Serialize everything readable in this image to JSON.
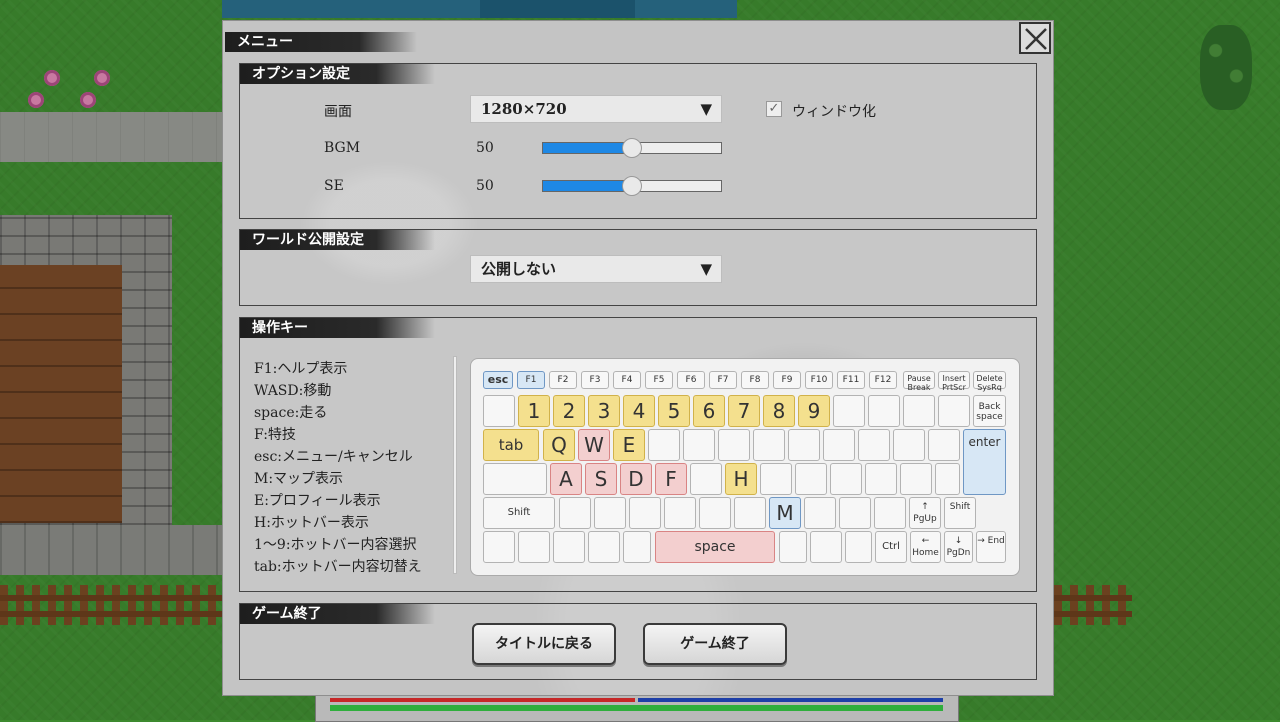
{
  "menu": {
    "title": "メニュー",
    "close_label": "×"
  },
  "options": {
    "title": "オプション設定",
    "screen": {
      "label": "画面",
      "value": "1280×720",
      "caret": "▼"
    },
    "windowed": {
      "label": "ウィンドウ化",
      "checked": true,
      "mark": "✓"
    },
    "bgm": {
      "label": "BGM",
      "value": "50",
      "level": 0.5
    },
    "se": {
      "label": "SE",
      "value": "50",
      "level": 0.5
    }
  },
  "world": {
    "title": "ワールド公開設定",
    "value": "公開しない",
    "caret": "▼"
  },
  "controls": {
    "title": "操作キー",
    "list": [
      "F1:ヘルプ表示",
      "WASD:移動",
      "space:走る",
      "F:特技",
      "esc:メニュー/キャンセル",
      "M:マップ表示",
      "E:プロフィール表示",
      "H:ホットバー表示",
      "1～9:ホットバー内容選択",
      "tab:ホットバー内容切替え"
    ],
    "keyboard": {
      "fn_row": [
        "esc",
        "F1",
        "F2",
        "F3",
        "F4",
        "F5",
        "F6",
        "F7",
        "F8",
        "F9",
        "F10",
        "F11",
        "F12",
        "Pause Break",
        "Insert PrtScr",
        "Delete SysRq"
      ],
      "num_row": [
        "",
        "1",
        "2",
        "3",
        "4",
        "5",
        "6",
        "7",
        "8",
        "9",
        "",
        "",
        "",
        "",
        "Back space"
      ],
      "tab_row": [
        "tab",
        "Q",
        "W",
        "E",
        "",
        "",
        "",
        "",
        "",
        "",
        "",
        "",
        "",
        "enter"
      ],
      "home_row": [
        "",
        "A",
        "S",
        "D",
        "F",
        "",
        "H",
        "",
        "",
        "",
        "",
        "",
        ""
      ],
      "shift_row": [
        "Shift",
        "",
        "",
        "",
        "",
        "",
        "",
        "M",
        "",
        "",
        "",
        "↑ PgUp",
        "Shift"
      ],
      "bottom_row": [
        "",
        "",
        "",
        "",
        "",
        "space",
        "",
        "",
        "",
        "Ctrl",
        "← Home",
        "↓ PgDn",
        "→ End"
      ]
    }
  },
  "exit": {
    "title": "ゲーム終了",
    "to_title": "タイトルに戻る",
    "quit": "ゲーム終了"
  }
}
